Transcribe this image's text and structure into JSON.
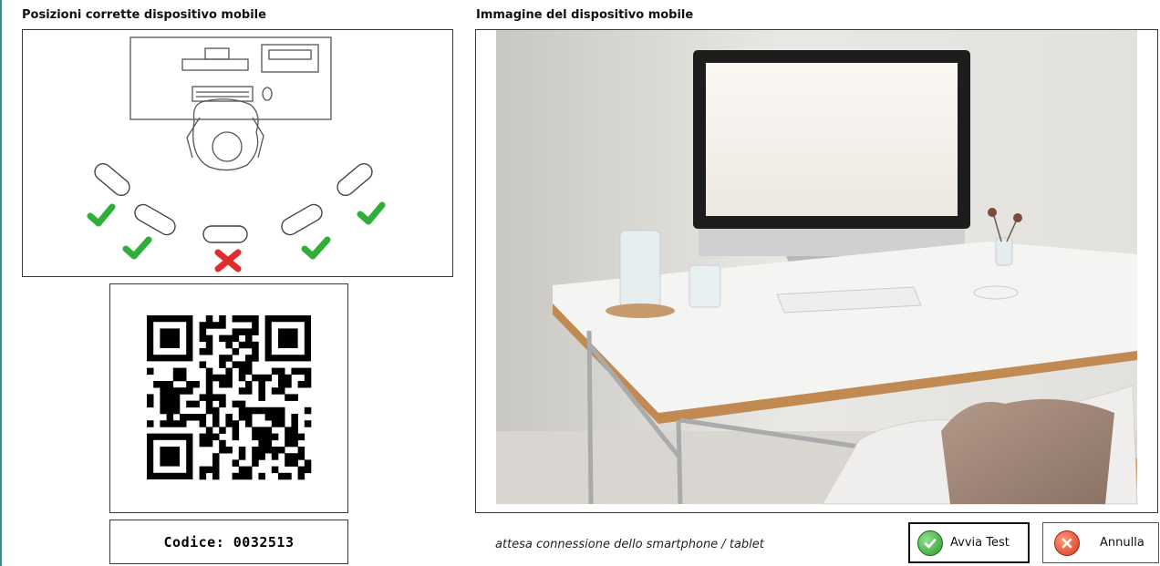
{
  "sections": {
    "positions_title": "Posizioni corrette dispositivo mobile",
    "image_title": "Immagine del dispositivo mobile"
  },
  "code": {
    "label": "Codice: 0032513"
  },
  "status": {
    "text": "attesa connessione dello smartphone / tablet"
  },
  "buttons": {
    "start_label": "Avvia Test",
    "cancel_label": "Annulla"
  },
  "icons": {
    "start": "check-circle-icon",
    "cancel": "x-circle-icon"
  },
  "colors": {
    "accent_rule": "#2f8f86",
    "ok_green": "#2fae3a",
    "error_red": "#e02c2c"
  }
}
